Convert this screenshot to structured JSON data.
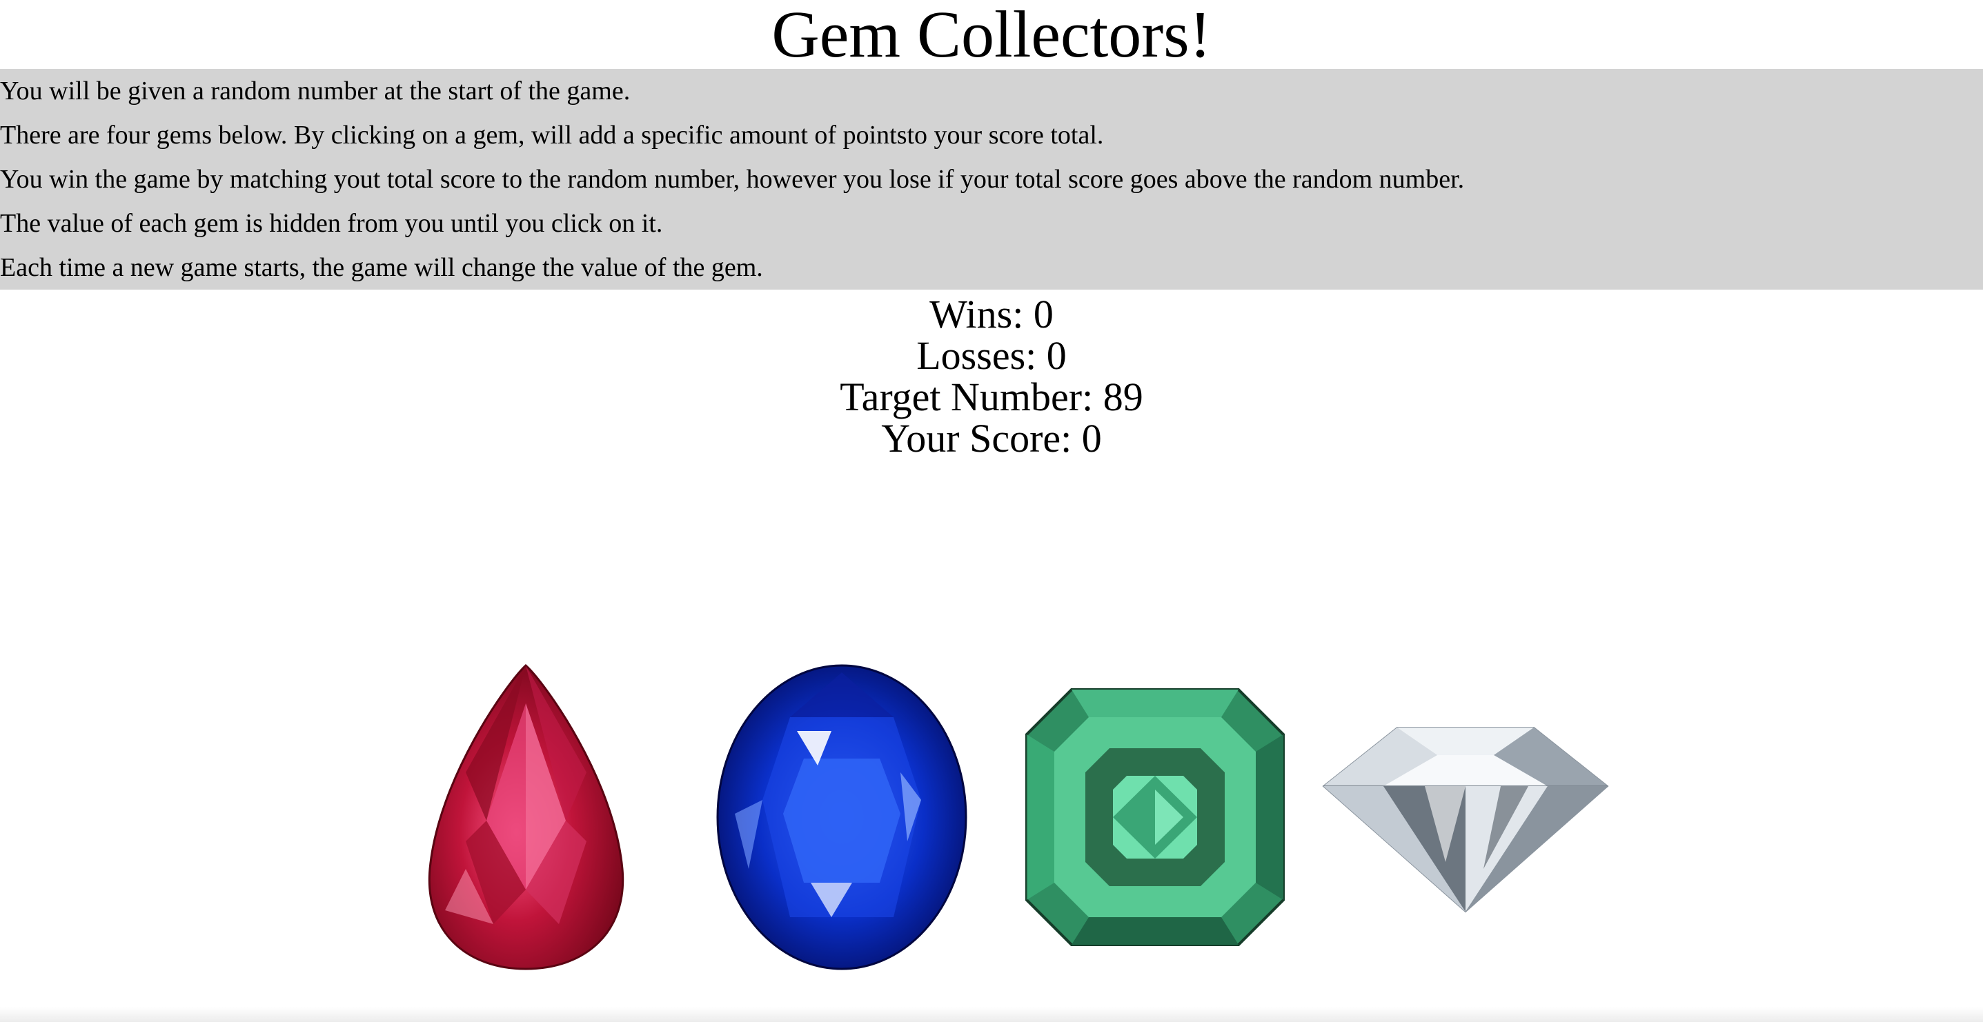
{
  "title": "Gem Collectors!",
  "instructions": [
    "You will be given a random number at the start of the game.",
    "There are four gems below. By clicking on a gem, will add a specific amount of pointsto your score total.",
    "You win the game by matching yout total score to the random number, however you lose if your total score goes above the random number.",
    "The value of each gem is hidden from you until you click on it.",
    "Each time a new game starts, the game will change the value of the gem."
  ],
  "stats": {
    "wins": "Wins: 0",
    "losses": "Losses: 0",
    "target": "Target Number: 89",
    "score": "Your Score: 0"
  },
  "gems": [
    {
      "icon": "ruby-gem-icon",
      "color": "#b01030"
    },
    {
      "icon": "sapphire-gem-icon",
      "color": "#0a2fc8"
    },
    {
      "icon": "emerald-gem-icon",
      "color": "#3cbf84"
    },
    {
      "icon": "diamond-gem-icon",
      "color": "#cfd6de"
    }
  ]
}
